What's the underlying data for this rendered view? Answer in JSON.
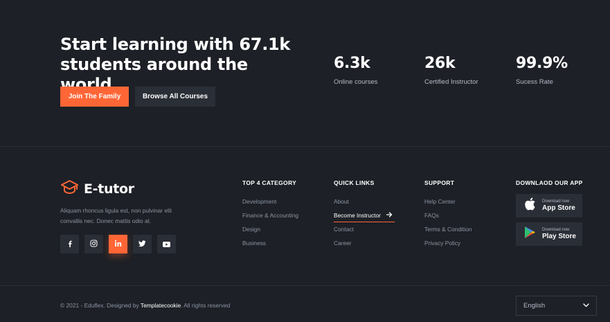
{
  "hero": {
    "title": "Start learning with 67.1k students around the world.",
    "primary_button": "Join The Family",
    "secondary_button": "Browse All Courses"
  },
  "stats": [
    {
      "value": "6.3k",
      "label": "Online courses"
    },
    {
      "value": "26k",
      "label": "Certified Instructor"
    },
    {
      "value": "99.9%",
      "label": "Sucess Rate"
    }
  ],
  "brand": {
    "name": "E-tutor",
    "description": "Aliquam rhoncus ligula est, non pulvinar elit convallis nec. Donec mattis odio at."
  },
  "social": [
    {
      "icon": "facebook-icon",
      "active": false
    },
    {
      "icon": "instagram-icon",
      "active": false
    },
    {
      "icon": "linkedin-icon",
      "active": true
    },
    {
      "icon": "twitter-icon",
      "active": false
    },
    {
      "icon": "youtube-icon",
      "active": false
    }
  ],
  "columns": {
    "category": {
      "heading": "TOP 4 CATEGORY",
      "links": [
        "Development",
        "Finance & Accounting",
        "Design",
        "Business"
      ]
    },
    "quick": {
      "heading": "QUICK LINKS",
      "links": [
        "About",
        "Become Instructor",
        "Contact",
        "Career"
      ]
    },
    "support": {
      "heading": "SUPPORT",
      "links": [
        "Help Center",
        "FAQs",
        "Terms & Condition",
        "Privacy Policy"
      ]
    },
    "app": {
      "heading": "DOWNLAOD OUR APP"
    }
  },
  "stores": [
    {
      "small": "Download now",
      "big": "App Store",
      "icon": "apple-icon"
    },
    {
      "small": "Download now",
      "big": "Play Store",
      "icon": "google-play-icon"
    }
  ],
  "footer": {
    "copyright_prefix": "© 2021 - Eduflex. Designed by ",
    "designer": "Templatecookie",
    "copyright_suffix": ". All rights reserved",
    "language": "English"
  },
  "colors": {
    "background": "#1d2026",
    "accent": "#ff6636",
    "surface": "#2a2e36"
  }
}
